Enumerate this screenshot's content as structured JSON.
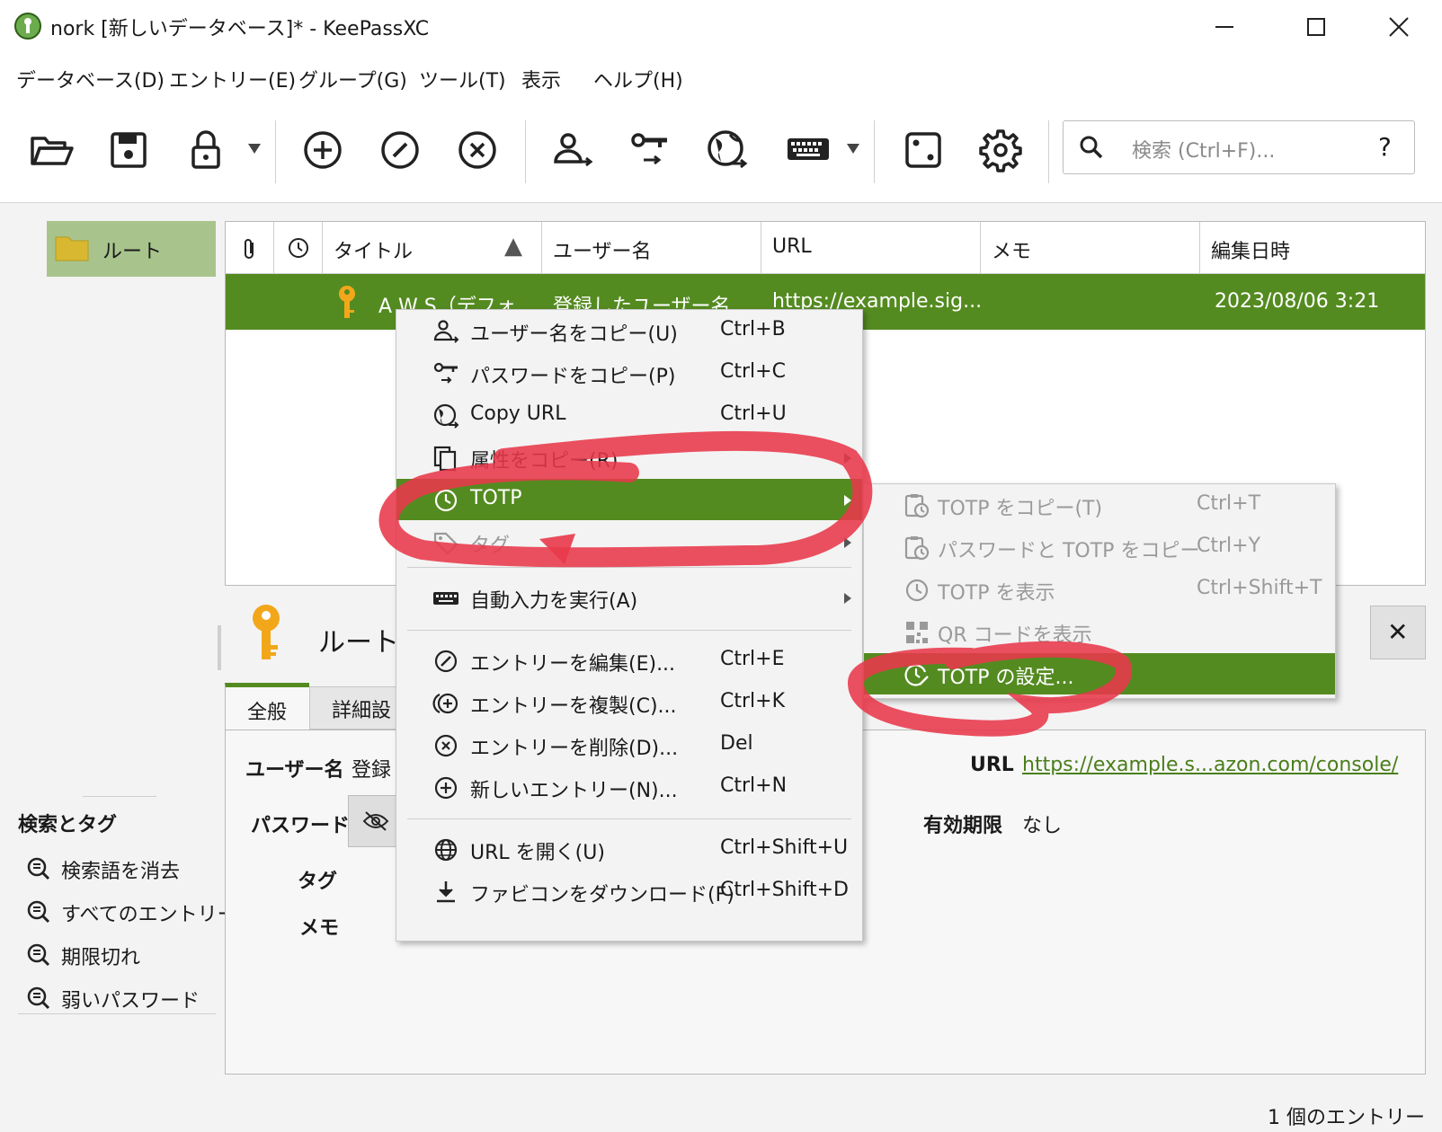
{
  "window": {
    "title": "nork [新しいデータベース]* - KeePassXC",
    "minimize": "—",
    "maximize": "☐",
    "close": "✕"
  },
  "menubar": [
    "データベース(D)",
    "エントリー(E)",
    "グループ(G)",
    "ツール(T)",
    "表示",
    "ヘルプ(H)"
  ],
  "toolbar": {
    "search_placeholder": "検索 (Ctrl+F)...",
    "search_help": "?"
  },
  "groups": {
    "root_label": "ルート"
  },
  "table": {
    "headers": [
      "タイトル",
      "ユーザー名",
      "URL",
      "メモ",
      "編集日時"
    ],
    "sort_indicator": "▲",
    "row": {
      "title": "A W S（デフォ...",
      "username": "登録したユーザー名",
      "url": "https://example.sig...",
      "notes": "",
      "modified": "2023/08/06 3:21"
    }
  },
  "search_tags": {
    "heading": "検索とタグ",
    "items": [
      "検索語を消去",
      "すべてのエントリー",
      "期限切れ",
      "弱いパスワード"
    ]
  },
  "details": {
    "breadcrumb": "ルート /",
    "tabs": [
      "全般",
      "詳細設"
    ],
    "close": "✕",
    "username_label": "ユーザー名",
    "username_value": "登録",
    "password_label": "パスワード",
    "tags_label": "タグ",
    "notes_label": "メモ",
    "url_label": "URL",
    "url_value": "https://example.s...azon.com/console/",
    "expiry_label": "有効期限",
    "expiry_value": "なし"
  },
  "context_menu": {
    "items": [
      {
        "label": "ユーザー名をコピー(U)",
        "shortcut": "Ctrl+B",
        "icon": "user-copy-icon"
      },
      {
        "label": "パスワードをコピー(P)",
        "shortcut": "Ctrl+C",
        "icon": "key-copy-icon"
      },
      {
        "label": "Copy URL",
        "shortcut": "Ctrl+U",
        "icon": "globe-copy-icon"
      },
      {
        "label": "属性をコピー(R)",
        "shortcut": "",
        "icon": "copy-icon"
      },
      {
        "label": "TOTP",
        "shortcut": "",
        "icon": "clock-icon"
      },
      {
        "label": "タグ",
        "shortcut": "",
        "icon": "tag-icon"
      },
      {
        "label": "自動入力を実行(A)",
        "shortcut": "",
        "icon": "keyboard-icon"
      },
      {
        "label": "エントリーを編集(E)...",
        "shortcut": "Ctrl+E",
        "icon": "edit-icon"
      },
      {
        "label": "エントリーを複製(C)...",
        "shortcut": "Ctrl+K",
        "icon": "clone-icon"
      },
      {
        "label": "エントリーを削除(D)...",
        "shortcut": "Del",
        "icon": "delete-icon"
      },
      {
        "label": "新しいエントリー(N)...",
        "shortcut": "Ctrl+N",
        "icon": "add-icon"
      },
      {
        "label": "URL を開く(U)",
        "shortcut": "Ctrl+Shift+U",
        "icon": "globe-icon"
      },
      {
        "label": "ファビコンをダウンロード(F)",
        "shortcut": "Ctrl+Shift+D",
        "icon": "download-icon"
      }
    ]
  },
  "totp_submenu": {
    "items": [
      {
        "label": "TOTP をコピー(T)",
        "shortcut": "Ctrl+T",
        "icon": "clipboard-clock-icon"
      },
      {
        "label": "パスワードと TOTP をコピー",
        "shortcut": "Ctrl+Y",
        "icon": "clipboard-clock-icon"
      },
      {
        "label": "TOTP を表示",
        "shortcut": "Ctrl+Shift+T",
        "icon": "clock-icon"
      },
      {
        "label": "QR コードを表示",
        "shortcut": "",
        "icon": "qr-code-icon"
      },
      {
        "label": "TOTP の設定...",
        "shortcut": "",
        "icon": "clock-settings-icon"
      }
    ]
  },
  "status": "1 個のエントリー",
  "colors": {
    "selection": "#548b20",
    "group_selected": "#a8c48c",
    "annotation": "#e8384a"
  }
}
